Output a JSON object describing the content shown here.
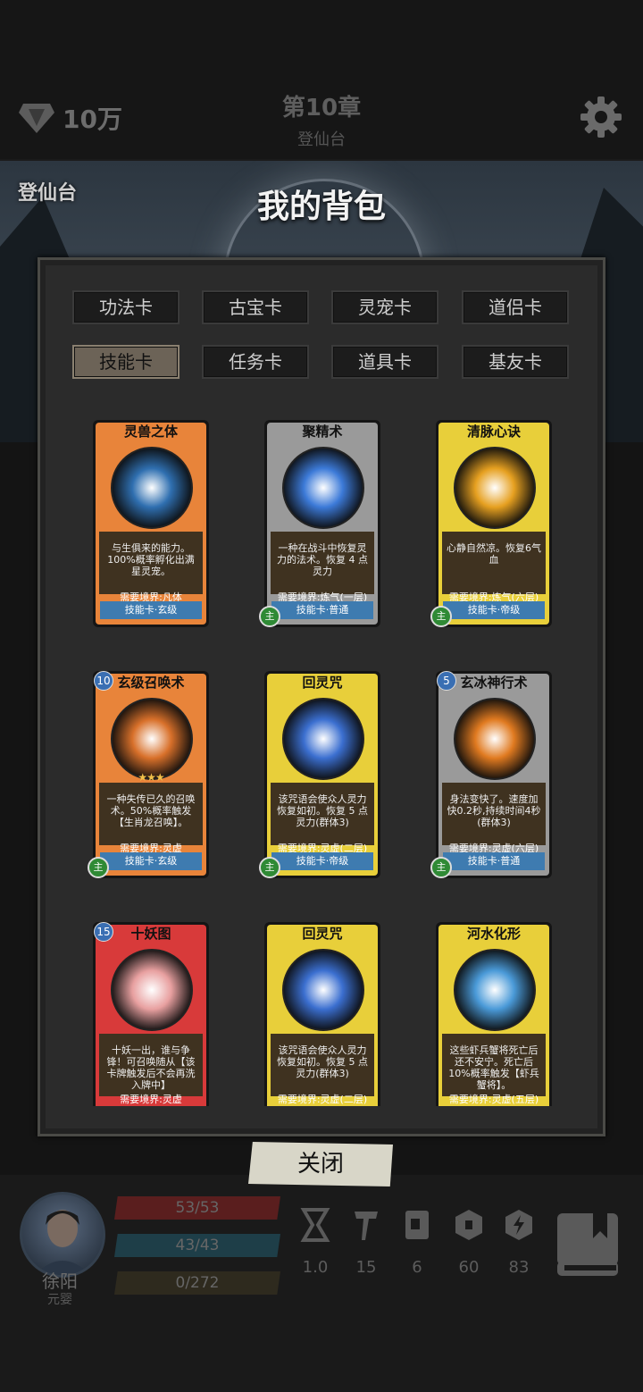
{
  "header": {
    "currency": "10万",
    "chapter": "第10章",
    "location": "登仙台"
  },
  "scene_label": "登仙台",
  "backpack": {
    "title": "我的背包",
    "tabs": [
      "功法卡",
      "古宝卡",
      "灵宠卡",
      "道侣卡",
      "技能卡",
      "任务卡",
      "道具卡",
      "基友卡"
    ],
    "active_tab": "技能卡",
    "close_label": "关闭"
  },
  "cards": [
    {
      "name": "灵兽之体",
      "desc": "与生俱来的能力。100%概率孵化出满星灵宠。",
      "req": "需要境界:凡体",
      "type": "技能卡·玄级",
      "level": "",
      "main": "",
      "frame": "#e8843a",
      "art": "#2f6fb0"
    },
    {
      "name": "聚精术",
      "desc": "一种在战斗中恢复灵力的法术。恢复 4 点灵力",
      "req": "需要境界:炼气(一层)",
      "type": "技能卡·普通",
      "level": "",
      "main": "主",
      "frame": "#9a9a9a",
      "art": "#3c7ad8"
    },
    {
      "name": "清脉心诀",
      "desc": "心静自然凉。恢复6气血",
      "req": "需要境界:炼气(六层)",
      "type": "技能卡·帝级",
      "level": "",
      "main": "主",
      "frame": "#e8cf3a",
      "art": "#e6a020"
    },
    {
      "name": "玄级召唤术",
      "desc": "一种失传已久的召唤术。50%概率触发【生肖龙召唤】。",
      "req": "需要境界:灵虚",
      "type": "技能卡·玄级",
      "level": "10",
      "main": "主",
      "frame": "#e8843a",
      "art": "#d8702a",
      "stars": "★★★"
    },
    {
      "name": "回灵咒",
      "desc": "该咒语会使众人灵力恢复如初。恢复 5 点灵力(群体3)",
      "req": "需要境界:灵虚(二层)",
      "type": "技能卡·帝级",
      "level": "",
      "main": "主",
      "frame": "#e8cf3a",
      "art": "#3b6fd0"
    },
    {
      "name": "玄冰神行术",
      "desc": "身法变快了。速度加快0.2秒,持续时间4秒(群体3)",
      "req": "需要境界:灵虚(六层)",
      "type": "技能卡·普通",
      "level": "5",
      "main": "主",
      "frame": "#9a9a9a",
      "art": "#e07a20"
    },
    {
      "name": "十妖图",
      "desc": "十妖一出，谁与争锋！可召唤随从【该卡牌触发后不会再洗入牌中】",
      "req": "需要境界:灵虚",
      "type": "",
      "level": "15",
      "main": "",
      "frame": "#d83a3a",
      "art": "#e8a0a0"
    },
    {
      "name": "回灵咒",
      "desc": "该咒语会使众人灵力恢复如初。恢复 5 点灵力(群体3)",
      "req": "需要境界:灵虚(二层)",
      "type": "",
      "level": "",
      "main": "",
      "frame": "#e8cf3a",
      "art": "#3b6fd0"
    },
    {
      "name": "河水化形",
      "desc": "这些虾兵蟹将死亡后还不安宁。死亡后10%概率触发【虾兵蟹将】。",
      "req": "需要境界:灵虚(五层)",
      "type": "",
      "level": "",
      "main": "",
      "frame": "#e8cf3a",
      "art": "#4a9ad8"
    }
  ],
  "player": {
    "name": "徐阳",
    "rank": "元婴",
    "hp": "53/53",
    "mp": "43/43",
    "exp": "0/272"
  },
  "stats": [
    {
      "icon": "hourglass-icon",
      "value": "1.0"
    },
    {
      "icon": "hammer-icon",
      "value": "15"
    },
    {
      "icon": "card-icon",
      "value": "6"
    },
    {
      "icon": "shield-icon",
      "value": "60"
    },
    {
      "icon": "lightning-shield-icon",
      "value": "83"
    }
  ]
}
